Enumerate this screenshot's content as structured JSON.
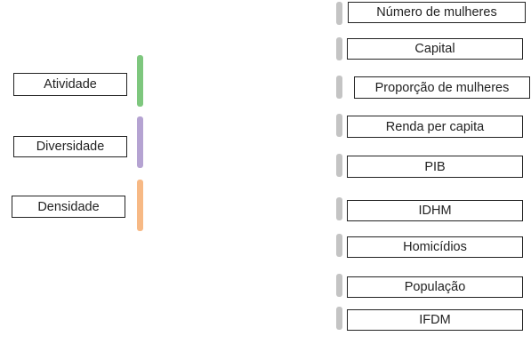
{
  "left_boxes": [
    {
      "label": "Atividade",
      "bar_color": "#7ec77e"
    },
    {
      "label": "Diversidade",
      "bar_color": "#b5a3d2"
    },
    {
      "label": "Densidade",
      "bar_color": "#f7b985"
    }
  ],
  "right_boxes": [
    {
      "label": "Número de mulheres"
    },
    {
      "label": "Capital"
    },
    {
      "label": "Proporção de mulheres"
    },
    {
      "label": "Renda per capita"
    },
    {
      "label": "PIB"
    },
    {
      "label": "IDHM"
    },
    {
      "label": "Homicídios"
    },
    {
      "label": "População"
    },
    {
      "label": "IFDM"
    }
  ],
  "connector_color": "#c4c4c4"
}
